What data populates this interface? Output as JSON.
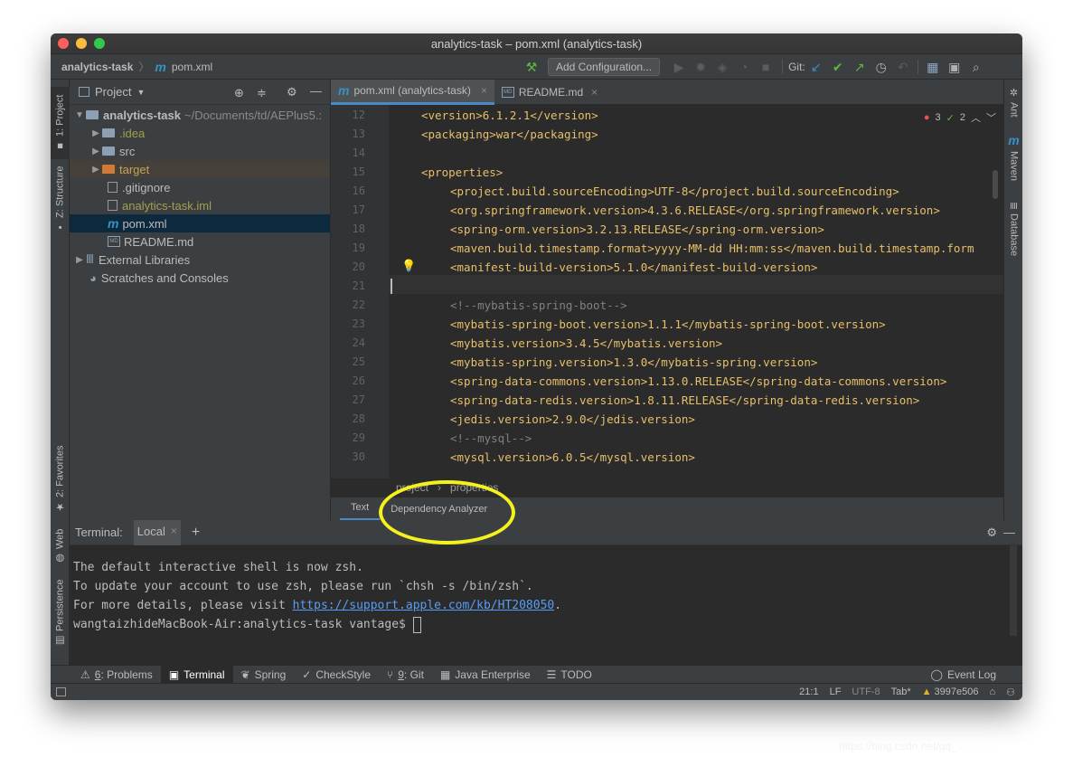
{
  "window": {
    "title": "analytics-task – pom.xml (analytics-task)"
  },
  "navbar": {
    "project": "analytics-task",
    "file": "pom.xml",
    "add_config": "Add Configuration...",
    "git_label": "Git:"
  },
  "left_strip": {
    "project": "1: Project",
    "structure": "Z: Structure",
    "favorites": "2: Favorites",
    "web": "Web",
    "persistence": "Persistence"
  },
  "right_strip": {
    "ant": "Ant",
    "maven": "Maven",
    "database": "Database"
  },
  "project_panel": {
    "title": "Project",
    "root": {
      "name": "analytics-task",
      "path": "~/Documents/td/AEPlus5.:"
    },
    "items": [
      {
        "name": ".idea",
        "type": "folder"
      },
      {
        "name": "src",
        "type": "folder"
      },
      {
        "name": "target",
        "type": "folder-excluded"
      },
      {
        "name": ".gitignore",
        "type": "file"
      },
      {
        "name": "analytics-task.iml",
        "type": "file"
      },
      {
        "name": "pom.xml",
        "type": "maven"
      },
      {
        "name": "README.md",
        "type": "md"
      }
    ],
    "external_libraries": "External Libraries",
    "scratches": "Scratches and Consoles"
  },
  "editor": {
    "tabs": [
      {
        "label": "pom.xml (analytics-task)",
        "icon": "maven-icon",
        "active": true
      },
      {
        "label": "README.md",
        "icon": "markdown-icon",
        "active": false
      }
    ],
    "inspection": {
      "errors": "3",
      "warnings": "2"
    },
    "lines": [
      {
        "n": "12",
        "indent": 1,
        "text": "<version>6.1.2.1</version>"
      },
      {
        "n": "13",
        "indent": 1,
        "text": "<packaging>war</packaging>"
      },
      {
        "n": "14",
        "indent": 0,
        "text": ""
      },
      {
        "n": "15",
        "indent": 1,
        "text": "<properties>"
      },
      {
        "n": "16",
        "indent": 2,
        "text": "<project.build.sourceEncoding>UTF-8</project.build.sourceEncoding>"
      },
      {
        "n": "17",
        "indent": 2,
        "text": "<org.springframework.version>4.3.6.RELEASE</org.springframework.version>"
      },
      {
        "n": "18",
        "indent": 2,
        "text": "<spring-orm.version>3.2.13.RELEASE</spring-orm.version>"
      },
      {
        "n": "19",
        "indent": 2,
        "text": "<maven.build.timestamp.format>yyyy-MM-dd HH:mm:ss</maven.build.timestamp.form"
      },
      {
        "n": "20",
        "indent": 2,
        "text": "<manifest-build-version>5.1.0</manifest-build-version>"
      },
      {
        "n": "21",
        "indent": 0,
        "text": ""
      },
      {
        "n": "22",
        "indent": 2,
        "text": "<!--mybatis-spring-boot-->"
      },
      {
        "n": "23",
        "indent": 2,
        "text": "<mybatis-spring-boot.version>1.1.1</mybatis-spring-boot.version>"
      },
      {
        "n": "24",
        "indent": 2,
        "text": "<mybatis.version>3.4.5</mybatis.version>"
      },
      {
        "n": "25",
        "indent": 2,
        "text": "<mybatis-spring.version>1.3.0</mybatis-spring.version>"
      },
      {
        "n": "26",
        "indent": 2,
        "text": "<spring-data-commons.version>1.13.0.RELEASE</spring-data-commons.version>"
      },
      {
        "n": "27",
        "indent": 2,
        "text": "<spring-data-redis.version>1.8.11.RELEASE</spring-data-redis.version>"
      },
      {
        "n": "28",
        "indent": 2,
        "text": "<jedis.version>2.9.0</jedis.version>"
      },
      {
        "n": "29",
        "indent": 2,
        "text": "<!--mysql-->"
      },
      {
        "n": "30",
        "indent": 2,
        "text": "<mysql.version>6.0.5</mysql.version>"
      }
    ],
    "breadcrumb": [
      "project",
      "properties"
    ],
    "bottom_tabs": [
      "Text",
      "Dependency Analyzer"
    ]
  },
  "terminal": {
    "label": "Terminal:",
    "tab": "Local",
    "lines": [
      "The default interactive shell is now zsh.",
      "To update your account to use zsh, please run `chsh -s /bin/zsh`."
    ],
    "details_prefix": "For more details, please visit ",
    "details_link": "https://support.apple.com/kb/HT208050",
    "details_suffix": ".",
    "prompt": "wangtaizhideMacBook-Air:analytics-task vantage$ "
  },
  "toolwindows": [
    {
      "key": "6",
      "label": ": Problems",
      "icon": "problems-icon"
    },
    {
      "key": "",
      "label": "Terminal",
      "icon": "terminal-icon",
      "active": true
    },
    {
      "key": "",
      "label": "Spring",
      "icon": "spring-icon"
    },
    {
      "key": "",
      "label": "CheckStyle",
      "icon": "checkstyle-icon"
    },
    {
      "key": "9",
      "label": ": Git",
      "icon": "git-icon"
    },
    {
      "key": "",
      "label": "Java Enterprise",
      "icon": "java-enterprise-icon"
    },
    {
      "key": "",
      "label": "TODO",
      "icon": "todo-icon"
    }
  ],
  "event_log": "Event Log",
  "status": {
    "position": "21:1",
    "line_sep": "LF",
    "encoding": "UTF-8",
    "indent": "Tab*",
    "git_rev": "3997e506"
  },
  "watermark": "https://blog.csdn.net/qq_..."
}
